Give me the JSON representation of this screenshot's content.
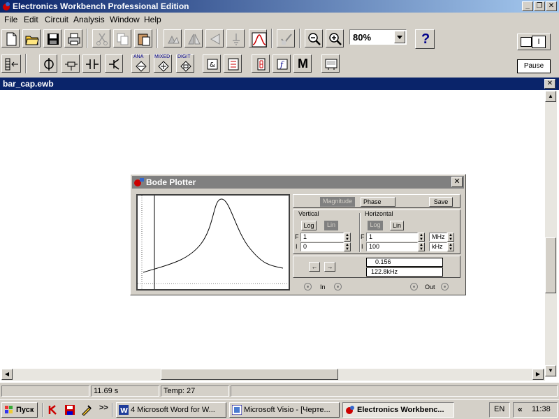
{
  "app": {
    "title": "Electronics Workbench Professional Edition"
  },
  "menu": [
    "File",
    "Edit",
    "Circuit",
    "Analysis",
    "Window",
    "Help"
  ],
  "toolbar": {
    "zoom": "80%",
    "help": "?",
    "power_label": "I",
    "pause_label": "Pause",
    "parts_labels": {
      "analog": "ANA",
      "mixed": "MIXED",
      "digital": "DIGIT",
      "misc": "M"
    }
  },
  "document": {
    "title": "bar_cap.ewb"
  },
  "bode": {
    "title": "Bode Plotter",
    "magnitude_label": "Magnitude",
    "phase_label": "Phase",
    "save_label": "Save",
    "vertical_label": "Vertical",
    "horizontal_label": "Horizontal",
    "log_label": "Log",
    "lin_label": "Lin",
    "f_label": "F",
    "i_label": "I",
    "vertical": {
      "final": "1",
      "initial": "0"
    },
    "horizontal": {
      "final": "1",
      "final_unit": "MHz",
      "initial": "100",
      "initial_unit": "kHz"
    },
    "readout_value": "0.156",
    "readout_freq": "122.8kHz",
    "in_label": "In",
    "out_label": "Out",
    "arrow_left": "←",
    "arrow_right": "→"
  },
  "status": {
    "time": "11.69 s",
    "temp": "Temp:  27"
  },
  "taskbar": {
    "start": "Пуск",
    "quicklaunch": ">>",
    "tasks": [
      "4 Microsoft Word for W...",
      "Microsoft Visio - [Черте...",
      "Electronics Workbenc..."
    ],
    "lang": "EN",
    "tray_more": "«",
    "clock": "11:38"
  }
}
